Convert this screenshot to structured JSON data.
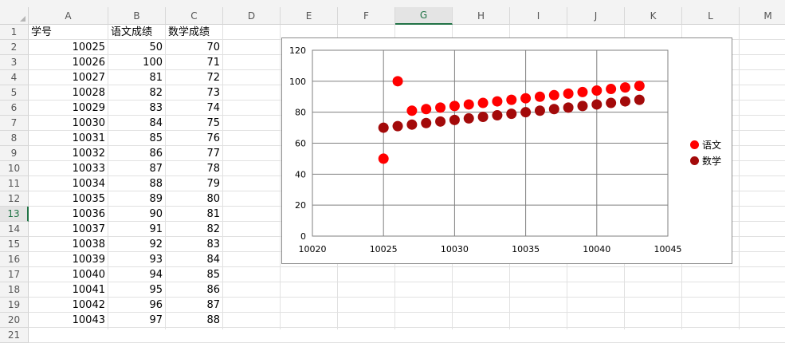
{
  "sheet": {
    "columns": [
      "A",
      "B",
      "C",
      "D",
      "E",
      "F",
      "G",
      "H",
      "I",
      "J",
      "K",
      "L",
      "M"
    ],
    "active_column": "G",
    "active_row": "13",
    "rows": [
      "1",
      "2",
      "3",
      "4",
      "5",
      "6",
      "7",
      "8",
      "9",
      "10",
      "11",
      "12",
      "13",
      "14",
      "15",
      "16",
      "17",
      "18",
      "19",
      "20",
      "21"
    ],
    "header": [
      "学号",
      "语文成绩",
      "数学成绩"
    ],
    "data": [
      [
        "10025",
        "50",
        "70"
      ],
      [
        "10026",
        "100",
        "71"
      ],
      [
        "10027",
        "81",
        "72"
      ],
      [
        "10028",
        "82",
        "73"
      ],
      [
        "10029",
        "83",
        "74"
      ],
      [
        "10030",
        "84",
        "75"
      ],
      [
        "10031",
        "85",
        "76"
      ],
      [
        "10032",
        "86",
        "77"
      ],
      [
        "10033",
        "87",
        "78"
      ],
      [
        "10034",
        "88",
        "79"
      ],
      [
        "10035",
        "89",
        "80"
      ],
      [
        "10036",
        "90",
        "81"
      ],
      [
        "10037",
        "91",
        "82"
      ],
      [
        "10038",
        "92",
        "83"
      ],
      [
        "10039",
        "93",
        "84"
      ],
      [
        "10040",
        "94",
        "85"
      ],
      [
        "10041",
        "95",
        "86"
      ],
      [
        "10042",
        "96",
        "87"
      ],
      [
        "10043",
        "97",
        "88"
      ]
    ]
  },
  "chart_data": {
    "type": "scatter",
    "xlim": [
      10020,
      10045
    ],
    "ylim": [
      0,
      120
    ],
    "x_ticks": [
      "10020",
      "10025",
      "10030",
      "10035",
      "10040",
      "10045"
    ],
    "y_ticks": [
      "0",
      "20",
      "40",
      "60",
      "80",
      "100",
      "120"
    ],
    "grid": true,
    "legend_position": "right",
    "x": [
      10025,
      10026,
      10027,
      10028,
      10029,
      10030,
      10031,
      10032,
      10033,
      10034,
      10035,
      10036,
      10037,
      10038,
      10039,
      10040,
      10041,
      10042,
      10043
    ],
    "series": [
      {
        "name": "语文",
        "color": "#ff0000",
        "values": [
          50,
          100,
          81,
          82,
          83,
          84,
          85,
          86,
          87,
          88,
          89,
          90,
          91,
          92,
          93,
          94,
          95,
          96,
          97
        ]
      },
      {
        "name": "数学",
        "color": "#a30a0a",
        "values": [
          70,
          71,
          72,
          73,
          74,
          75,
          76,
          77,
          78,
          79,
          80,
          81,
          82,
          83,
          84,
          85,
          86,
          87,
          88
        ]
      }
    ]
  },
  "colors": {
    "accent": "#217346",
    "series1": "#ff0000",
    "series2": "#a30a0a"
  }
}
